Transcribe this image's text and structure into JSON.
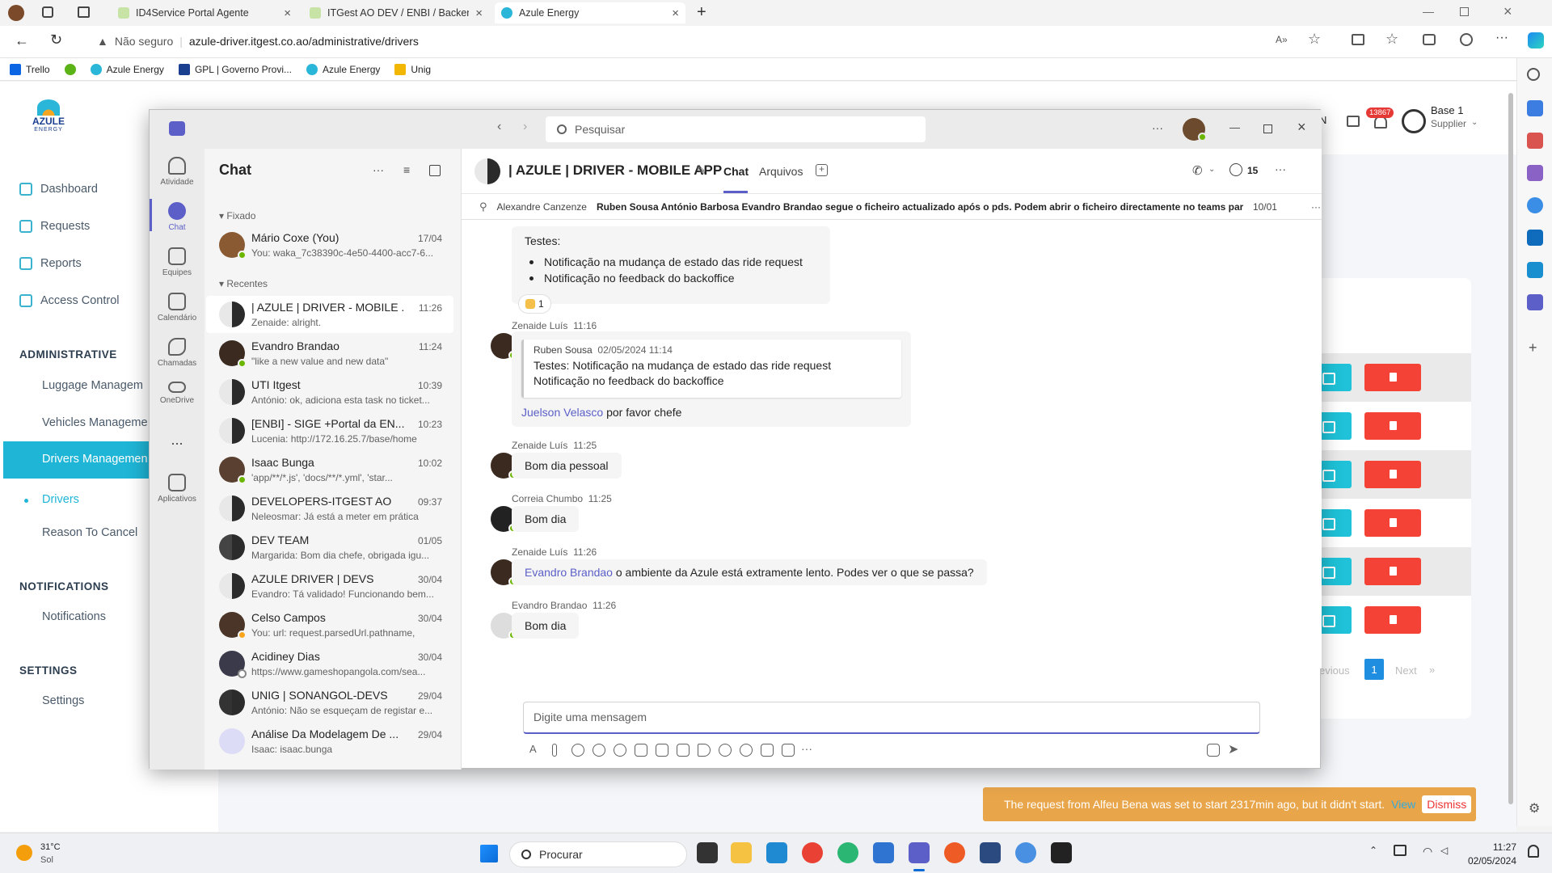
{
  "browser": {
    "tabs": [
      {
        "title": "ID4Service Portal Agente"
      },
      {
        "title": "ITGest AO DEV / ENBI / Backend"
      },
      {
        "title": "Azule Energy"
      }
    ],
    "security_label": "Não seguro",
    "url": "azule-driver.itgest.co.ao/administrative/drivers",
    "bookmarks": [
      "Trello",
      "Azule Energy",
      "GPL | Governo Provi...",
      "Azule Energy",
      "Unig"
    ]
  },
  "webapp": {
    "logo_text": "AZULE",
    "logo_sub": "ENERGY",
    "nav": {
      "dashboard": "Dashboard",
      "requests": "Requests",
      "reports": "Reports",
      "access_control": "Access Control",
      "administrative": "ADMINISTRATIVE",
      "luggage": "Luggage Managem",
      "vehicles": "Vehicles Manageme",
      "drivers_management": "Drivers Managemen",
      "drivers": "Drivers",
      "reason": "Reason To Cancel",
      "notifications_section": "NOTIFICATIONS",
      "notifications": "Notifications",
      "settings_section": "SETTINGS",
      "settings": "Settings"
    },
    "user": {
      "name": "Base 1",
      "role": "Supplier",
      "badge": "13867",
      "letter": "N"
    },
    "pagination": {
      "prev": "evious",
      "page": "1",
      "next": "Next",
      "last": "»"
    },
    "toast": {
      "text": "The request from Alfeu Bena was set to start 2317min ago, but it didn't start.",
      "view": "View",
      "dismiss": "Dismiss"
    }
  },
  "teams": {
    "search_placeholder": "Pesquisar",
    "rail": [
      {
        "label": "Atividade"
      },
      {
        "label": "Chat"
      },
      {
        "label": "Equipes"
      },
      {
        "label": "Calendário"
      },
      {
        "label": "Chamadas"
      },
      {
        "label": "OneDrive"
      },
      {
        "label": "..."
      },
      {
        "label": "Aplicativos"
      }
    ],
    "list_title": "Chat",
    "pinned_label": "Fixado",
    "recent_label": "Recentes",
    "pinned": [
      {
        "name": "Mário Coxe (You)",
        "time": "17/04",
        "preview": "You: waka_7c38390c-4e50-4400-acc7-6..."
      }
    ],
    "recent": [
      {
        "name": "| AZULE | DRIVER - MOBILE ...",
        "time": "11:26",
        "preview": "Zenaide: alright."
      },
      {
        "name": "Evandro Brandao",
        "time": "11:24",
        "preview": "\"like a new value and new data\""
      },
      {
        "name": "UTI Itgest",
        "time": "10:39",
        "preview": "António: ok, adiciona esta task no ticket..."
      },
      {
        "name": "[ENBI] - SIGE +Portal da EN...",
        "time": "10:23",
        "preview": "Lucenia: http://172.16.25.7/base/home"
      },
      {
        "name": "Isaac Bunga",
        "time": "10:02",
        "preview": "'app/**/*.js',      'docs/**/*.yml',      'star..."
      },
      {
        "name": "DEVELOPERS-ITGEST AO",
        "time": "09:37",
        "preview": "Neleosmar: Já está a meter em prática"
      },
      {
        "name": "DEV TEAM",
        "time": "01/05",
        "preview": "Margarida: Bom dia chefe, obrigada igu..."
      },
      {
        "name": "AZULE DRIVER | DEVS",
        "time": "30/04",
        "preview": "Evandro: Tá validado! Funcionando bem..."
      },
      {
        "name": "Celso Campos",
        "time": "30/04",
        "preview": "You: url: request.parsedUrl.pathname,"
      },
      {
        "name": "Acidiney Dias",
        "time": "30/04",
        "preview": "https://www.gameshopangola.com/sea..."
      },
      {
        "name": "UNIG | SONANGOL-DEVS",
        "time": "29/04",
        "preview": "António: Não se esqueçam de registar e..."
      },
      {
        "name": "Análise Da Modelagem De ...",
        "time": "29/04",
        "preview": "Isaac: isaac.bunga"
      }
    ],
    "conversation": {
      "title": "| AZULE | DRIVER - MOBILE APP",
      "tab_chat": "Chat",
      "tab_files": "Arquivos",
      "participants": "15",
      "pinned_author": "Alexandre Canzenze",
      "pinned_text": "Ruben Sousa António Barbosa Evandro Brandao segue o ficheiro actualizado após o pds. Podem abrir o ficheiro directamente no teams para act...",
      "pinned_date": "10/01"
    },
    "messages": {
      "m1_heading": "Testes:",
      "m1_item1": "Notificação na mudança de estado das ride request",
      "m1_item2": "Notificação no feedback do backoffice",
      "m1_reaction": "1",
      "m2_author": "Zenaide Luís",
      "m2_time": "11:16",
      "m2_quote_author": "Ruben Sousa",
      "m2_quote_time": "02/05/2024 11:14",
      "m2_quote_line1": "Testes: Notificação na mudança de estado das ride request",
      "m2_quote_line2": "Notificação no feedback do backoffice",
      "m2_mention": "Juelson Velasco",
      "m2_text": "por favor chefe",
      "m3_author": "Zenaide Luís",
      "m3_time": "11:25",
      "m3_text": "Bom dia pessoal",
      "m4_author": "Correia Chumbo",
      "m4_time": "11:25",
      "m4_text": "Bom dia",
      "m5_author": "Zenaide Luís",
      "m5_time": "11:26",
      "m5_mention": "Evandro Brandao",
      "m5_text": "o ambiente da Azule está extramente lento. Podes ver o que se passa?",
      "m6_author": "Evandro Brandao",
      "m6_time": "11:26",
      "m6_text": "Bom dia"
    },
    "compose_placeholder": "Digite uma mensagem"
  },
  "taskbar": {
    "weather_temp": "31°C",
    "weather_desc": "Sol",
    "search": "Procurar",
    "time": "11:27",
    "date": "02/05/2024"
  },
  "colors": {
    "teams_purple": "#5b5fc7",
    "app_cyan": "#1fb5d6",
    "delete_red": "#f44336",
    "toast_orange": "#e8a54a",
    "presence_green": "#6bb700"
  }
}
